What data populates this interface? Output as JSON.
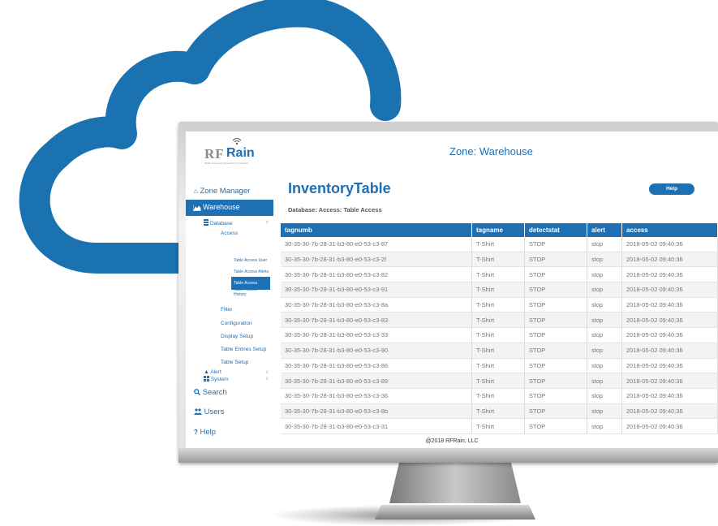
{
  "header": {
    "logo_rf": "RF",
    "logo_rain": "Rain",
    "logo_tagline": "Radio Frequency Research & Innovation",
    "zone_title": "Zone: Warehouse"
  },
  "sidebar": {
    "zone_manager": "Zone Manager",
    "warehouse": "Warehouse",
    "database": "Database",
    "access": "Access",
    "table_access": "Table Access",
    "table_access_user": "Table Access User",
    "table_access_alerts": "Table Access Alerts",
    "table_access_history": "Table Access History",
    "filter": "Filter",
    "configuration": "Configuration",
    "display_setup": "Display Setup",
    "table_entries_setup": "Table Entries Setup",
    "table_setup": "Table Setup",
    "alert": "Alert",
    "system": "System",
    "search": "Search",
    "users": "Users",
    "help": "Help"
  },
  "main": {
    "title": "InventoryTable",
    "help_button": "Help",
    "subheader": "Database: Access: Table Access",
    "columns": [
      "tagnumb",
      "tagname",
      "detectstat",
      "alert",
      "access"
    ],
    "rows": [
      [
        "30-35-30-7b-28-31-b3-80-e0-53-c3-87",
        "T-Shirt",
        "STOP",
        "stop",
        "2018-05-02 09:40:36"
      ],
      [
        "30-35-30-7b-28-31-b3-80-e0-53-c3-2f",
        "T-Shirt",
        "STOP",
        "stop",
        "2018-05-02 09:40:36"
      ],
      [
        "30-35-30-7b-28-31-b3-80-e0-53-c3-82",
        "T-Shirt",
        "STOP",
        "stop",
        "2018-05-02 09:40:36"
      ],
      [
        "30-35-30-7b-28-31-b3-80-e0-53-c3-91",
        "T-Shirt",
        "STOP",
        "stop",
        "2018-05-02 09:40:36"
      ],
      [
        "30-35-30-7b-28-31-b3-80-e0-53-c3-8a",
        "T-Shirt",
        "STOP",
        "stop",
        "2018-05-02 09:40:36"
      ],
      [
        "30-35-30-7b-28-31-b3-80-e0-53-c3-83",
        "T-Shirt",
        "STOP",
        "stop",
        "2018-05-02 09:40:36"
      ],
      [
        "30-35-30-7b-28-31-b3-80-e0-53-c3-33",
        "T-Shirt",
        "STOP",
        "stop",
        "2018-05-02 09:40:36"
      ],
      [
        "30-35-30-7b-28-31-b3-80-e0-53-c3-90",
        "T-Shirt",
        "STOP",
        "stop",
        "2018-05-02 09:40:36"
      ],
      [
        "30-35-30-7b-28-31-b3-80-e0-53-c3-86",
        "T-Shirt",
        "STOP",
        "stop",
        "2018-05-02 09:40:36"
      ],
      [
        "30-35-30-7b-28-31-b3-80-e0-53-c3-89",
        "T-Shirt",
        "STOP",
        "stop",
        "2018-05-02 09:40:36"
      ],
      [
        "30-35-30-7b-28-31-b3-80-e0-53-c3-36",
        "T-Shirt",
        "STOP",
        "stop",
        "2018-05-02 09:40:36"
      ],
      [
        "30-35-30-7b-28-31-b3-80-e0-53-c3-8b",
        "T-Shirt",
        "STOP",
        "stop",
        "2018-05-02 09:40:36"
      ],
      [
        "30-35-30-7b-28-31-b3-80-e0-53-c3-31",
        "T-Shirt",
        "STOP",
        "stop",
        "2018-05-02 09:40:36"
      ]
    ]
  },
  "footer": {
    "copyright": "@2018 RFRain, LLC"
  },
  "colors": {
    "brand_blue": "#1f6fb3",
    "cloud_blue": "#1a73b0"
  },
  "icons": [
    "home-icon",
    "warehouse-icon",
    "database-icon",
    "bell-icon",
    "windows-icon",
    "search-icon",
    "users-icon",
    "question-icon",
    "wifi-icon"
  ]
}
